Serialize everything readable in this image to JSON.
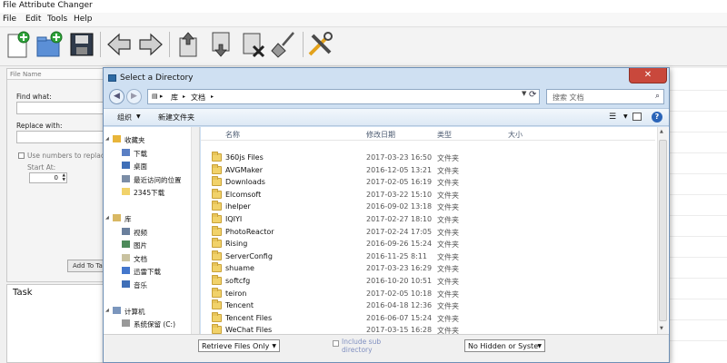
{
  "app": {
    "title": "File Attribute Changer",
    "menu": [
      "File",
      "Edit",
      "Tools",
      "Help"
    ]
  },
  "left_panel": {
    "file_name_header": "File Name",
    "find_label": "Find what:",
    "replace_label": "Replace with:",
    "use_numbers_label": "Use numbers to replace '#'",
    "start_at_label": "Start At:",
    "start_at_value": "0",
    "add_button": "Add To Task"
  },
  "task_panel": {
    "title": "Task"
  },
  "dialog": {
    "title": "Select a Directory",
    "close_glyph": "✕",
    "breadcrumb": [
      "库",
      "文档"
    ],
    "search_placeholder": "搜索 文档",
    "toolbar": {
      "organize": "组织",
      "new_folder": "新建文件夹"
    },
    "nav": [
      {
        "label": "收藏夹",
        "indent": 0,
        "icon": "star-icon",
        "color": "#e8b53a"
      },
      {
        "label": "下载",
        "indent": 1,
        "icon": "download-folder-icon",
        "color": "#5a7fc4"
      },
      {
        "label": "桌面",
        "indent": 1,
        "icon": "desktop-icon",
        "color": "#3f6fb8"
      },
      {
        "label": "最近访问的位置",
        "indent": 1,
        "icon": "recent-places-icon",
        "color": "#7b8da6"
      },
      {
        "label": "2345下载",
        "indent": 1,
        "icon": "folder-icon",
        "color": "#f1d26a"
      },
      {
        "label": "",
        "indent": 0,
        "icon": "",
        "color": ""
      },
      {
        "label": "库",
        "indent": 0,
        "icon": "library-icon",
        "color": "#d9b863"
      },
      {
        "label": "视频",
        "indent": 1,
        "icon": "video-library-icon",
        "color": "#6a7f9c"
      },
      {
        "label": "图片",
        "indent": 1,
        "icon": "picture-library-icon",
        "color": "#4d8a5a"
      },
      {
        "label": "文档",
        "indent": 1,
        "icon": "document-library-icon",
        "color": "#c9c2a0"
      },
      {
        "label": "迅雷下载",
        "indent": 1,
        "icon": "thunder-download-icon",
        "color": "#4477cc"
      },
      {
        "label": "音乐",
        "indent": 1,
        "icon": "music-library-icon",
        "color": "#3f6fb8"
      },
      {
        "label": "",
        "indent": 0,
        "icon": "",
        "color": ""
      },
      {
        "label": "计算机",
        "indent": 0,
        "icon": "computer-icon",
        "color": "#7b96bd"
      },
      {
        "label": "系统保留 (C:)",
        "indent": 1,
        "icon": "drive-icon",
        "color": "#999999"
      }
    ],
    "columns": {
      "name": "名称",
      "modified": "修改日期",
      "type": "类型",
      "size": "大小"
    },
    "files": [
      {
        "name": "360js Files",
        "date": "2017-03-23 16:50",
        "type": "文件夹"
      },
      {
        "name": "AVGMaker",
        "date": "2016-12-05 13:21",
        "type": "文件夹"
      },
      {
        "name": "Downloads",
        "date": "2017-02-05 16:19",
        "type": "文件夹"
      },
      {
        "name": "Elcomsoft",
        "date": "2017-03-22 15:10",
        "type": "文件夹"
      },
      {
        "name": "ihelper",
        "date": "2016-09-02 13:18",
        "type": "文件夹"
      },
      {
        "name": "IQIYI",
        "date": "2017-02-27 18:10",
        "type": "文件夹"
      },
      {
        "name": "PhotoReactor",
        "date": "2017-02-24 17:05",
        "type": "文件夹"
      },
      {
        "name": "Rising",
        "date": "2016-09-26 15:24",
        "type": "文件夹"
      },
      {
        "name": "ServerConfig",
        "date": "2016-11-25 8:11",
        "type": "文件夹"
      },
      {
        "name": "shuame",
        "date": "2017-03-23 16:29",
        "type": "文件夹"
      },
      {
        "name": "softcfg",
        "date": "2016-10-20 10:51",
        "type": "文件夹"
      },
      {
        "name": "teiron",
        "date": "2017-02-05 10:18",
        "type": "文件夹"
      },
      {
        "name": "Tencent",
        "date": "2016-04-18 12:36",
        "type": "文件夹"
      },
      {
        "name": "Tencent Files",
        "date": "2016-06-07 15:24",
        "type": "文件夹"
      },
      {
        "name": "WeChat Files",
        "date": "2017-03-15 16:28",
        "type": "文件夹"
      }
    ],
    "bottom": {
      "retrieve_option": "Retrieve Files Only",
      "include_sub_label": "Include sub directory",
      "hidden_option": "No Hidden or Syste"
    }
  },
  "colors": {
    "dialog_frame": "#cfe0f2",
    "close_button": "#c9483c",
    "folder": "#f1d26a"
  }
}
